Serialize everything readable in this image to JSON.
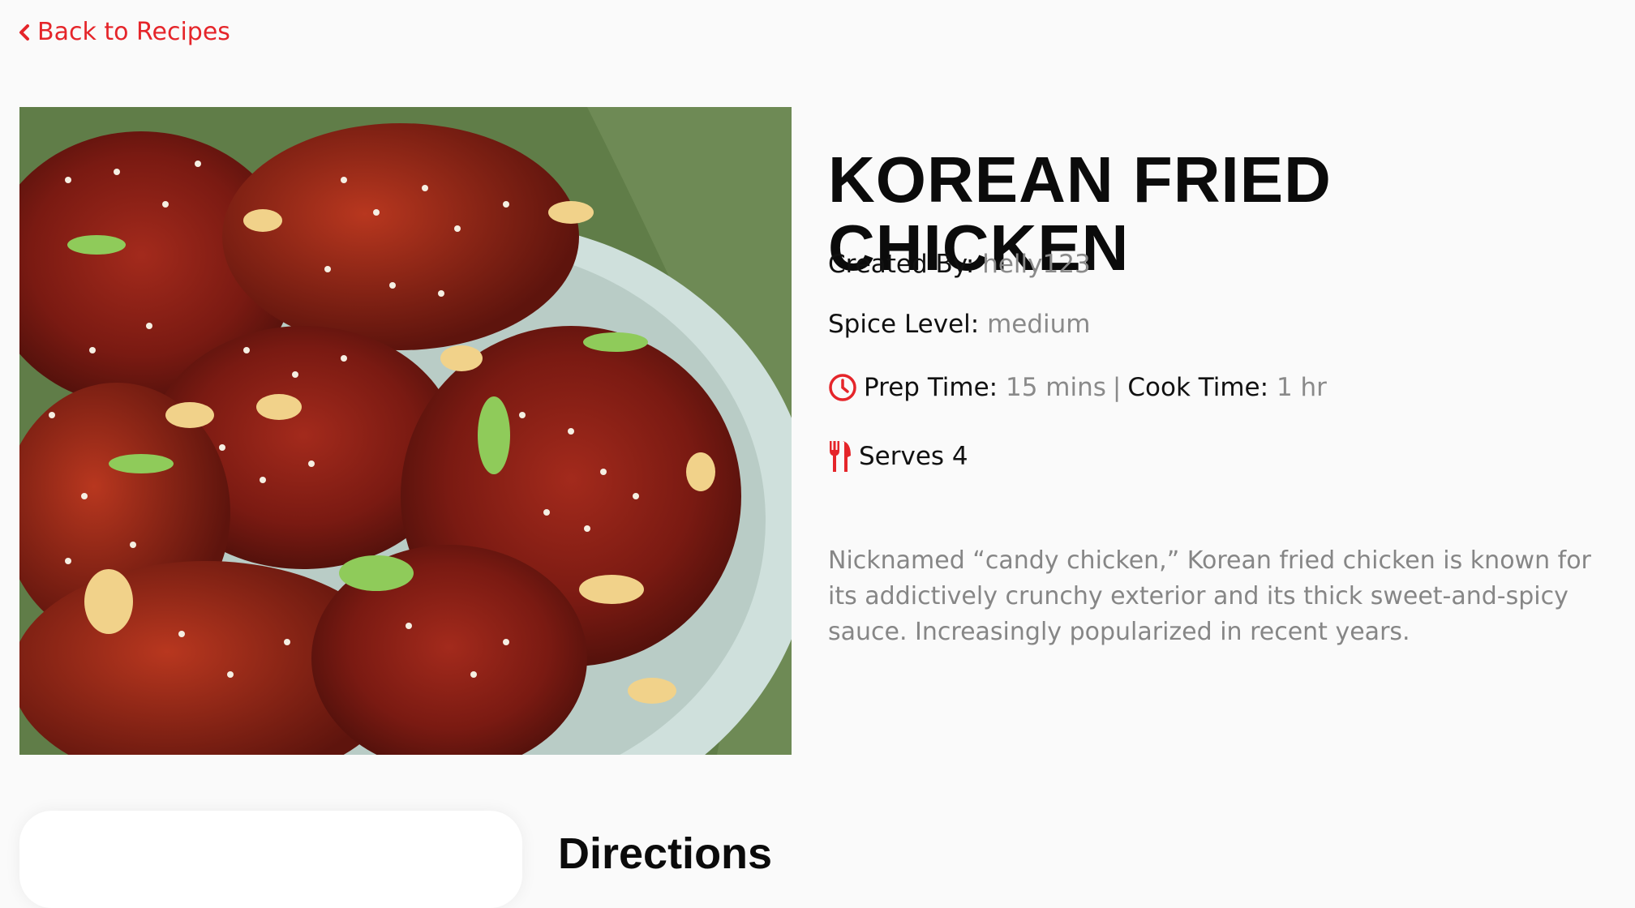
{
  "nav": {
    "back_label": "Back to Recipes"
  },
  "recipe": {
    "title": "KOREAN FRIED CHICKEN",
    "created_by_label": "Created By:",
    "created_by": "helly123",
    "spice_label": "Spice Level:",
    "spice": "medium",
    "prep_label": "Prep Time:",
    "prep": "15 mins",
    "separator": "|",
    "cook_label": "Cook Time:",
    "cook": "1 hr",
    "serves": "Serves 4",
    "description": "Nicknamed “candy chicken,” Korean fried chicken is known for its addictively crunchy exterior and its thick sweet-and-spicy sauce. Increasingly popularized in recent years."
  },
  "sections": {
    "directions_heading": "Directions"
  },
  "icons": {
    "back": "chevron-left-icon",
    "clock": "clock-icon",
    "utensils": "utensils-icon"
  },
  "colors": {
    "accent": "#e5252a",
    "muted": "#8a8a8a",
    "background": "#fafafa"
  }
}
